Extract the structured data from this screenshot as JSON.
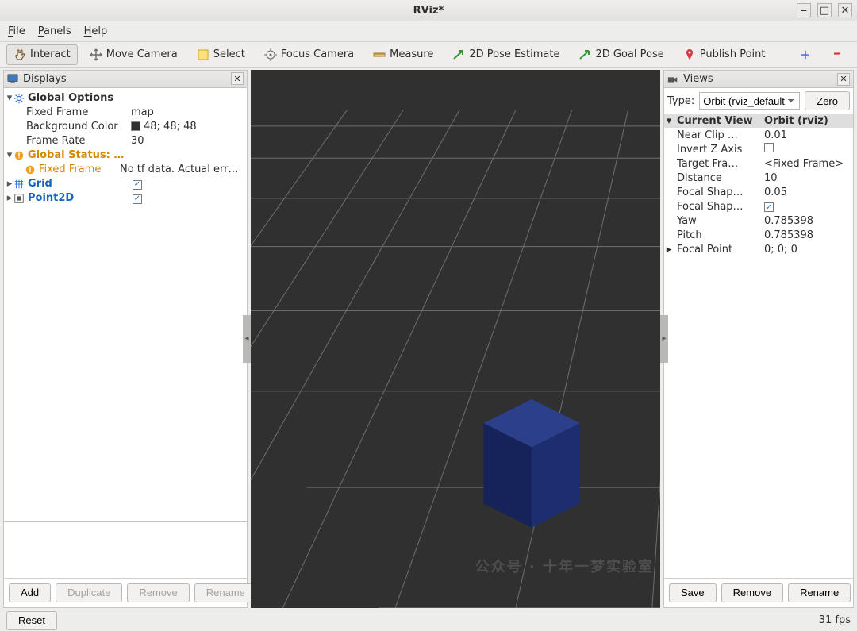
{
  "window": {
    "title": "RViz*"
  },
  "menus": {
    "file": "File",
    "panels": "Panels",
    "help": "Help"
  },
  "toolbar": {
    "interact": "Interact",
    "move_camera": "Move Camera",
    "select": "Select",
    "focus_camera": "Focus Camera",
    "measure": "Measure",
    "pose_estimate": "2D Pose Estimate",
    "goal_pose": "2D Goal Pose",
    "publish_point": "Publish Point"
  },
  "displays_panel": {
    "title": "Displays",
    "global_options": {
      "label": "Global Options",
      "fixed_frame": {
        "label": "Fixed Frame",
        "value": "map"
      },
      "background_color": {
        "label": "Background Color",
        "value": "48; 48; 48",
        "hex": "#303030"
      },
      "frame_rate": {
        "label": "Frame Rate",
        "value": "30"
      }
    },
    "global_status": {
      "label": "Global Status: …",
      "fixed_frame": {
        "label": "Fixed Frame",
        "value": "No tf data.  Actual err…"
      }
    },
    "grid": {
      "label": "Grid",
      "checked": true
    },
    "point2d": {
      "label": "Point2D",
      "checked": true
    },
    "buttons": {
      "add": "Add",
      "duplicate": "Duplicate",
      "remove": "Remove",
      "rename": "Rename"
    }
  },
  "views_panel": {
    "title": "Views",
    "type_label": "Type:",
    "type_value": "Orbit (rviz_default",
    "zero": "Zero",
    "hdr_key": "Current View",
    "hdr_val": "Orbit (rviz)",
    "props": {
      "near_clip": {
        "k": "Near Clip …",
        "v": "0.01"
      },
      "invert_z": {
        "k": "Invert Z Axis",
        "v": ""
      },
      "target_frame": {
        "k": "Target Fra…",
        "v": "<Fixed Frame>"
      },
      "distance": {
        "k": "Distance",
        "v": "10"
      },
      "focal_shape_size": {
        "k": "Focal Shap…",
        "v": "0.05"
      },
      "focal_shape_fixed": {
        "k": "Focal Shap…",
        "v": ""
      },
      "yaw": {
        "k": "Yaw",
        "v": "0.785398"
      },
      "pitch": {
        "k": "Pitch",
        "v": "0.785398"
      },
      "focal_point": {
        "k": "Focal Point",
        "v": "0; 0; 0"
      }
    },
    "buttons": {
      "save": "Save",
      "remove": "Remove",
      "rename": "Rename"
    }
  },
  "bottom": {
    "reset": "Reset",
    "fps": "31 fps"
  },
  "colors": {
    "viewport_bg": "#303030",
    "grid": "#6e6e6e",
    "cube_top": "#2b3f8a",
    "cube_left": "#16235a",
    "cube_right": "#1c2e70"
  }
}
